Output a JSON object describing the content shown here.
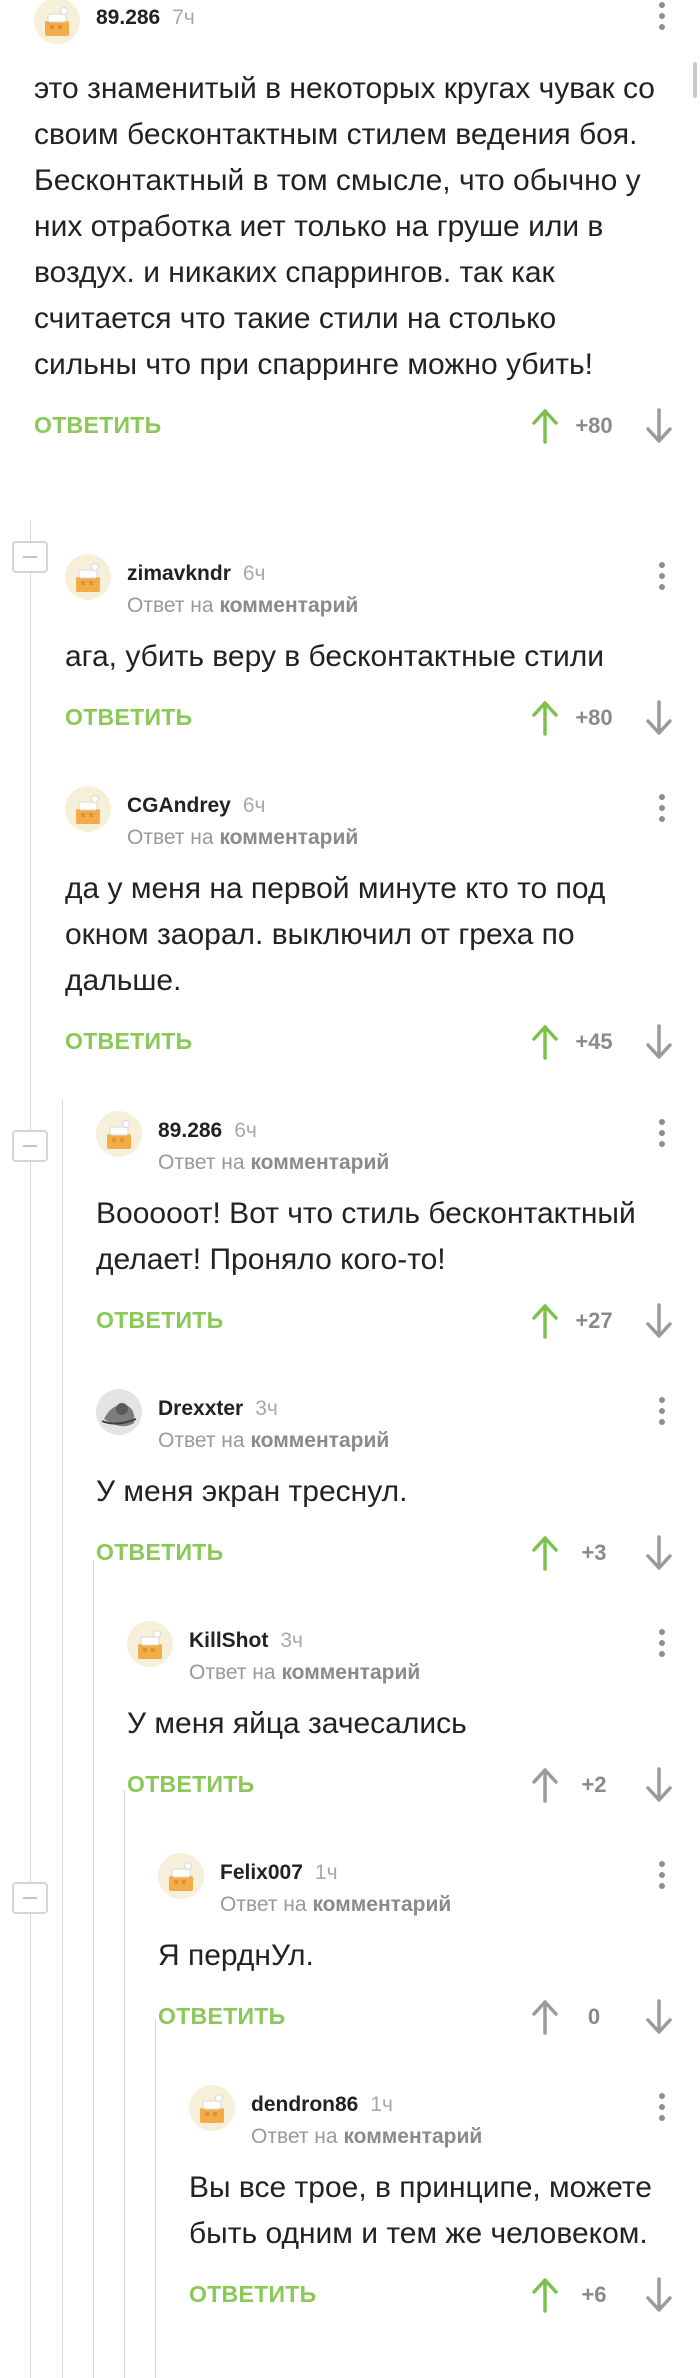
{
  "colors": {
    "accent": "#8ac858",
    "muted": "#999999",
    "text": "#222222"
  },
  "reply_label": "ОТВЕТИТЬ",
  "reply_to_prefix": "Ответ на",
  "reply_to_link": "комментарий",
  "comments": [
    {
      "user": "89.286",
      "time": "7ч",
      "avatar": "default-avatar-icon",
      "text": "это знаменитый в некоторых кругах чувак со своим бесконтактным стилем ведения боя.\nБесконтактный в том смысле, что обычно у них отработка иет только на груше или в воздух. и никаких спаррингов. так как считается что такие стили на столько сильны что при спарринге можно убить!",
      "rating": "+80",
      "upvoted": true
    },
    {
      "user": "zimavkndr",
      "time": "6ч",
      "avatar": "default-avatar-icon",
      "text": "ага, убить веру в бесконтактные стили",
      "rating": "+80",
      "upvoted": true
    },
    {
      "user": "CGAndrey",
      "time": "6ч",
      "avatar": "default-avatar-icon",
      "text": "да у меня на первой минуте кто то под окном заорал. выключил от греха по дальше.",
      "rating": "+45",
      "upvoted": true
    },
    {
      "user": "89.286",
      "time": "6ч",
      "avatar": "default-avatar-icon",
      "text": "Вооооот! Вот что стиль бесконтактный делает! Проняло кого-то!",
      "rating": "+27",
      "upvoted": true
    },
    {
      "user": "Drexxter",
      "time": "3ч",
      "avatar": "photo-avatar-icon",
      "text": "У меня экран треснул.",
      "rating": "+3",
      "upvoted": true
    },
    {
      "user": "KillShot",
      "time": "3ч",
      "avatar": "default-avatar-icon",
      "text": "У меня яйца зачесались",
      "rating": "+2",
      "upvoted": false
    },
    {
      "user": "Felix007",
      "time": "1ч",
      "avatar": "default-avatar-icon",
      "text": "Я перднУл.",
      "rating": "0",
      "upvoted": false
    },
    {
      "user": "dendron86",
      "time": "1ч",
      "avatar": "default-avatar-icon",
      "text": "Вы все трое, в принципе, можете быть одним и тем же человеком.",
      "rating": "+6",
      "upvoted": true
    }
  ]
}
